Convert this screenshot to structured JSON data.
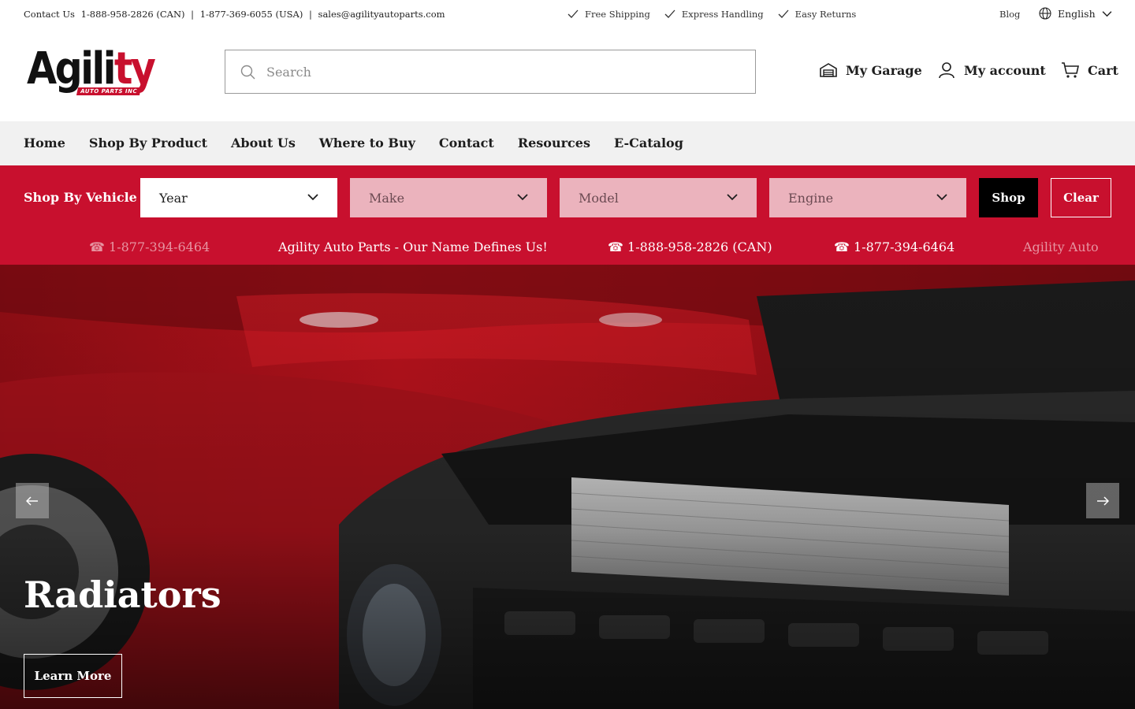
{
  "topbar": {
    "contact_label": "Contact Us",
    "phone_can": "1-888-958-2826 (CAN)",
    "phone_usa": "1-877-369-6055 (USA)",
    "email": "sales@agilityautoparts.com",
    "separator": "|",
    "perks": [
      "Free Shipping",
      "Express Handling",
      "Easy Returns"
    ],
    "blog": "Blog",
    "language": "English"
  },
  "header": {
    "logo_main_1": "Agili",
    "logo_main_2": "ty",
    "logo_sub": "AUTO PARTS INC",
    "search_placeholder": "Search",
    "garage": "My Garage",
    "account": "My account",
    "cart": "Cart"
  },
  "nav": {
    "items": [
      "Home",
      "Shop By Product",
      "About Us",
      "Where to Buy",
      "Contact",
      "Resources",
      "E-Catalog"
    ]
  },
  "vehicle": {
    "label": "Shop By Vehicle",
    "year": "Year",
    "make": "Make",
    "model": "Model",
    "engine": "Engine",
    "shop": "Shop",
    "clear": "Clear"
  },
  "ticker": {
    "items": [
      "☎ 1-877-394-6464",
      "Agility Auto Parts - Our Name Defines Us!",
      "☎ 1-888-958-2826 (CAN)",
      "☎ 1-877-394-6464",
      "Agility Auto"
    ]
  },
  "hero": {
    "title": "Radiators",
    "cta": "Learn More"
  },
  "colors": {
    "brand_red": "#c8102e",
    "nav_bg": "#f1f1f1",
    "disabled_select": "#ebb3bd"
  }
}
